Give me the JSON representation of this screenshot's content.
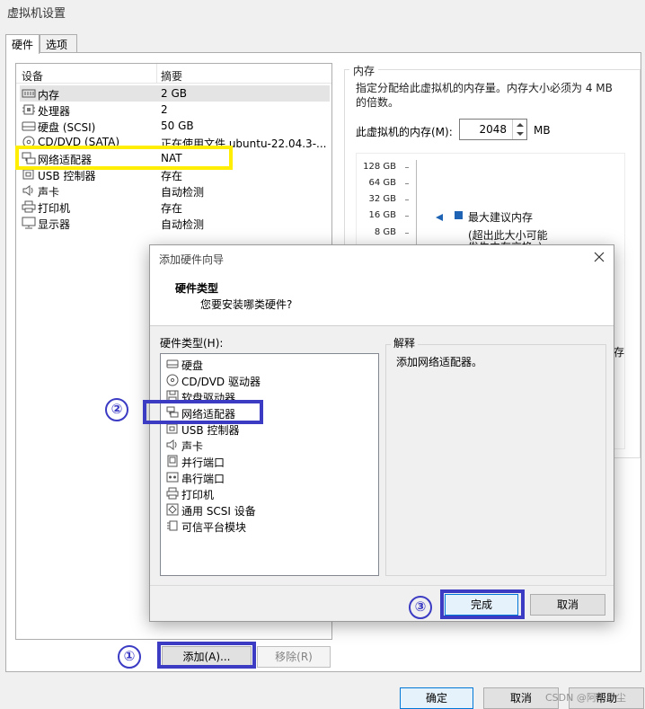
{
  "window": {
    "title": "虚拟机设置"
  },
  "tabs": [
    {
      "label": "硬件"
    },
    {
      "label": "选项"
    }
  ],
  "device_list": {
    "header_device": "设备",
    "header_summary": "摘要",
    "rows": [
      {
        "name": "内存",
        "summary": "2 GB",
        "icon": "memory-icon"
      },
      {
        "name": "处理器",
        "summary": "2",
        "icon": "cpu-icon"
      },
      {
        "name": "硬盘 (SCSI)",
        "summary": "50 GB",
        "icon": "hard-disk-icon"
      },
      {
        "name": "CD/DVD (SATA)",
        "summary": "正在使用文件 ubuntu-22.04.3-...",
        "icon": "cd-icon"
      },
      {
        "name": "网络适配器",
        "summary": "NAT",
        "icon": "network-icon"
      },
      {
        "name": "USB 控制器",
        "summary": "存在",
        "icon": "usb-icon"
      },
      {
        "name": "声卡",
        "summary": "自动检测",
        "icon": "speaker-icon"
      },
      {
        "name": "打印机",
        "summary": "存在",
        "icon": "printer-icon"
      },
      {
        "name": "显示器",
        "summary": "自动检测",
        "icon": "monitor-icon"
      }
    ],
    "add_button": "添加(A)...",
    "remove_button": "移除(R)"
  },
  "memory": {
    "group_title": "内存",
    "description": "指定分配给此虚拟机的内存量。内存大小必须为 4 MB 的倍数。",
    "field_label": "此虚拟机的内存(M):",
    "value": "2048",
    "unit": "MB",
    "scale": [
      "128 GB",
      "64 GB",
      "32 GB",
      "16 GB",
      "8 GB"
    ],
    "max_recommended": "最大建议内存",
    "max_note": "(超出此大小可能",
    "max_note_cut": "发生内存交换。)",
    "cut_char": "存"
  },
  "dialog": {
    "title": "添加硬件向导",
    "heading": "硬件类型",
    "subheading": "您要安装哪类硬件?",
    "list_label": "硬件类型(H):",
    "explain_title": "解释",
    "explain_text": "添加网络适配器。",
    "hardware_types": [
      {
        "name": "硬盘",
        "icon": "hard-disk-icon"
      },
      {
        "name": "CD/DVD 驱动器",
        "icon": "cd-icon"
      },
      {
        "name": "软盘驱动器",
        "icon": "floppy-icon"
      },
      {
        "name": "网络适配器",
        "icon": "network-icon"
      },
      {
        "name": "USB 控制器",
        "icon": "usb-icon"
      },
      {
        "name": "声卡",
        "icon": "speaker-icon"
      },
      {
        "name": "并行端口",
        "icon": "parallel-port-icon"
      },
      {
        "name": "串行端口",
        "icon": "serial-port-icon"
      },
      {
        "name": "打印机",
        "icon": "printer-icon"
      },
      {
        "name": "通用 SCSI 设备",
        "icon": "scsi-icon"
      },
      {
        "name": "可信平台模块",
        "icon": "tpm-icon"
      }
    ],
    "finish_button": "完成",
    "cancel_button": "取消"
  },
  "footer": {
    "ok_button": "确定",
    "cancel_button": "取消",
    "help_button": "帮助"
  },
  "annotations": {
    "step1": "①",
    "step2": "②",
    "step3": "③"
  },
  "watermark": "CSDN @阿牛小尘",
  "colors": {
    "highlight_yellow": "#ffee00",
    "highlight_blue": "#3b3bc4",
    "selection": "#e4e4e4",
    "accent": "#0078d7"
  }
}
